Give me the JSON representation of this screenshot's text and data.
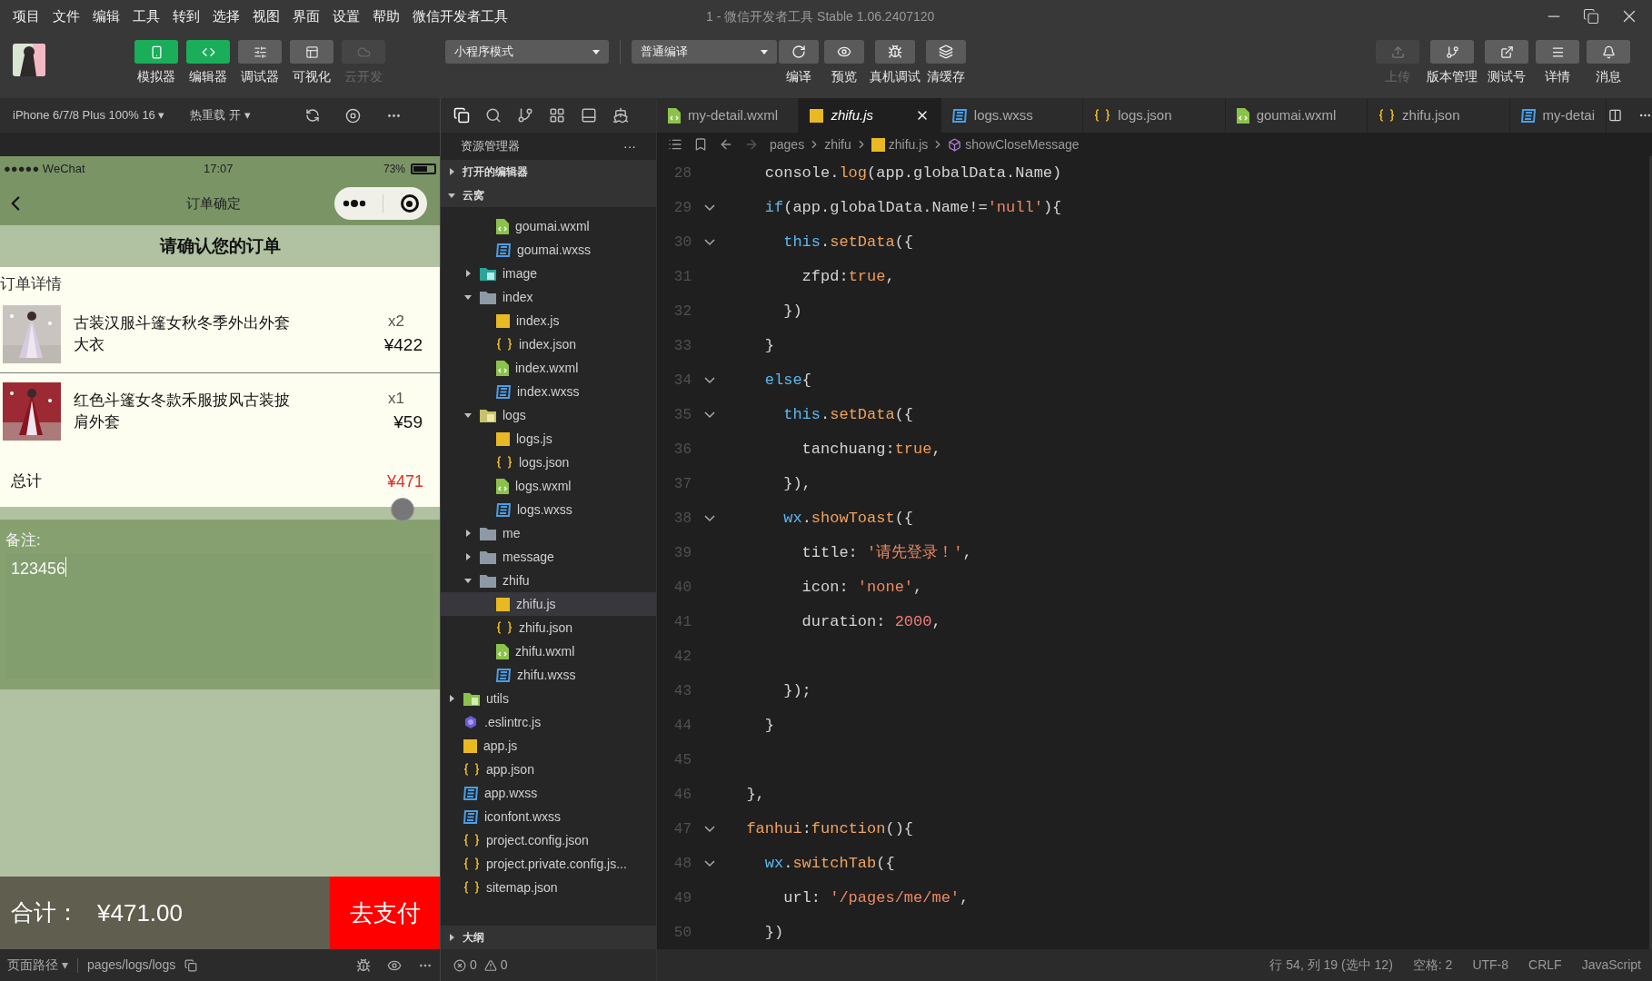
{
  "menu": [
    "项目",
    "文件",
    "编辑",
    "工具",
    "转到",
    "选择",
    "视图",
    "界面",
    "设置",
    "帮助",
    "微信开发者工具"
  ],
  "window": {
    "title": "1 - 微信开发者工具 Stable 1.06.2407120"
  },
  "toolbar": {
    "views": [
      {
        "label": "模拟器",
        "kind": "simulator",
        "on": true,
        "disabled": false
      },
      {
        "label": "编辑器",
        "kind": "editor",
        "on": true,
        "disabled": false
      },
      {
        "label": "调试器",
        "kind": "debugger",
        "on": false,
        "disabled": false
      },
      {
        "label": "可视化",
        "kind": "visual",
        "on": false,
        "disabled": false
      },
      {
        "label": "云开发",
        "kind": "cloud",
        "on": false,
        "disabled": true
      }
    ],
    "mode": "小程序模式",
    "compile": "普通编译",
    "actions": [
      {
        "label": "编译",
        "kind": "refresh"
      },
      {
        "label": "预览",
        "kind": "preview"
      },
      {
        "label": "真机调试",
        "kind": "bug"
      },
      {
        "label": "清缓存",
        "kind": "layers"
      }
    ],
    "right": [
      {
        "label": "上传",
        "kind": "upload",
        "disabled": true
      },
      {
        "label": "版本管理",
        "kind": "branch",
        "disabled": false
      },
      {
        "label": "测试号",
        "kind": "external",
        "disabled": false
      },
      {
        "label": "详情",
        "kind": "menu",
        "disabled": false
      },
      {
        "label": "消息",
        "kind": "bell",
        "disabled": false
      }
    ]
  },
  "simulator": {
    "device": "iPhone 6/7/8 Plus 100% 16 ▾",
    "hot_reload": "热重载 开 ▾",
    "status": {
      "carrier": "●●●●● WeChat",
      "time": "17:07",
      "battery": "73%"
    },
    "nav_title": "订单确定",
    "heading": "请确认您的订单",
    "section": "订单详情",
    "items": [
      {
        "name": "古装汉服斗篷女秋冬季外出外套大衣",
        "qty": "x2",
        "price": "¥422"
      },
      {
        "name": "红色斗篷女冬款禾服披风古装披肩外套",
        "qty": "x1",
        "price": "¥59"
      }
    ],
    "total_label": "总计",
    "total": "¥471",
    "remark_label": "备注:",
    "remark_value": "123456",
    "sum_label": "合计：",
    "sum": "¥471.00",
    "pay": "去支付",
    "path_label": "页面路径 ▾",
    "path": "pages/logs/logs"
  },
  "explorer": {
    "title": "资源管理器",
    "more": "···",
    "open_editors": {
      "label": "打开的编辑器",
      "expanded": false
    },
    "project": {
      "label": "云窝",
      "expanded": true
    },
    "outline": {
      "label": "大纲",
      "expanded": false
    }
  },
  "tree": {
    "items": [
      {
        "children": [
          {
            "children": [
              {
                "label": "goumai.wxml",
                "kind": "wxml",
                "selected": false
              },
              {
                "label": "goumai.wxss",
                "kind": "wxss",
                "selected": false
              }
            ]
          },
          {
            "label": "image",
            "kind": "image-folder",
            "expanded": false,
            "selected": false
          },
          {
            "label": "index",
            "kind": "folder",
            "expanded": true,
            "selected": false,
            "children": [
              {
                "label": "index.js",
                "kind": "js",
                "selected": false
              },
              {
                "label": "index.json",
                "kind": "json",
                "selected": false
              },
              {
                "label": "index.wxml",
                "kind": "wxml",
                "selected": false
              },
              {
                "label": "index.wxss",
                "kind": "wxss",
                "selected": false
              }
            ]
          },
          {
            "label": "logs",
            "kind": "logs-folder",
            "expanded": true,
            "selected": false,
            "children": [
              {
                "label": "logs.js",
                "kind": "js",
                "selected": false
              },
              {
                "label": "logs.json",
                "kind": "json",
                "selected": false
              },
              {
                "label": "logs.wxml",
                "kind": "wxml",
                "selected": false
              },
              {
                "label": "logs.wxss",
                "kind": "wxss",
                "selected": false
              }
            ]
          },
          {
            "label": "me",
            "kind": "folder",
            "expanded": false,
            "selected": false
          },
          {
            "label": "message",
            "kind": "folder",
            "expanded": false,
            "selected": false
          },
          {
            "label": "zhifu",
            "kind": "folder",
            "expanded": true,
            "selected": false,
            "children": [
              {
                "label": "zhifu.js",
                "kind": "js",
                "selected": true
              },
              {
                "label": "zhifu.json",
                "kind": "json",
                "selected": false
              },
              {
                "label": "zhifu.wxml",
                "kind": "wxml",
                "selected": false
              },
              {
                "label": "zhifu.wxss",
                "kind": "wxss",
                "selected": false
              }
            ]
          }
        ]
      },
      {
        "label": "utils",
        "kind": "utils-folder",
        "expanded": false,
        "selected": false
      },
      {
        "label": ".eslintrc.js",
        "kind": "eslint",
        "selected": false
      },
      {
        "label": "app.js",
        "kind": "js",
        "selected": false
      },
      {
        "label": "app.json",
        "kind": "json",
        "selected": false
      },
      {
        "label": "app.wxss",
        "kind": "wxss",
        "selected": false
      },
      {
        "label": "iconfont.wxss",
        "kind": "wxss",
        "selected": false
      },
      {
        "label": "project.config.json",
        "kind": "json",
        "selected": false
      },
      {
        "label": "project.private.config.js...",
        "kind": "json",
        "selected": false
      },
      {
        "label": "sitemap.json",
        "kind": "json",
        "selected": false
      }
    ]
  },
  "tabs": [
    {
      "label": "my-detail.wxml",
      "kind": "wxml",
      "selected": false
    },
    {
      "label": "zhifu.js",
      "kind": "js",
      "selected": true
    },
    {
      "label": "logs.wxss",
      "kind": "wxss",
      "selected": false
    },
    {
      "label": "logs.json",
      "kind": "json",
      "selected": false
    },
    {
      "label": "goumai.wxml",
      "kind": "wxml",
      "selected": false
    },
    {
      "label": "zhifu.json",
      "kind": "json",
      "selected": false
    },
    {
      "label": "my-detai",
      "kind": "wxss",
      "selected": false
    }
  ],
  "breadcrumb": [
    "pages",
    "zhifu",
    "zhifu.js",
    "showCloseMessage"
  ],
  "code": [
    {
      "number": "28",
      "fold": false,
      "tokens": [
        {
          "text": "    console.",
          "kind": "plain"
        },
        {
          "text": "log",
          "kind": "function"
        },
        {
          "text": "(app.globalData.Name)",
          "kind": "plain"
        }
      ]
    },
    {
      "number": "29",
      "fold": true,
      "tokens": [
        {
          "text": "    if",
          "kind": "keyword"
        },
        {
          "text": "(app.globalData.Name!=",
          "kind": "plain"
        },
        {
          "text": "'null'",
          "kind": "string"
        },
        {
          "text": "){",
          "kind": "plain"
        }
      ]
    },
    {
      "number": "30",
      "fold": true,
      "tokens": [
        {
          "text": "      this",
          "kind": "keyword"
        },
        {
          "text": ".",
          "kind": "plain"
        },
        {
          "text": "setData",
          "kind": "function"
        },
        {
          "text": "({",
          "kind": "plain"
        }
      ]
    },
    {
      "number": "31",
      "fold": false,
      "tokens": [
        {
          "text": "        zfpd:",
          "kind": "plain"
        },
        {
          "text": "true",
          "kind": "literal"
        },
        {
          "text": ",",
          "kind": "plain"
        }
      ]
    },
    {
      "number": "32",
      "fold": false,
      "tokens": [
        {
          "text": "      })",
          "kind": "plain"
        }
      ]
    },
    {
      "number": "33",
      "fold": false,
      "tokens": [
        {
          "text": "    }",
          "kind": "plain"
        }
      ]
    },
    {
      "number": "34",
      "fold": true,
      "tokens": [
        {
          "text": "    else",
          "kind": "keyword"
        },
        {
          "text": "{",
          "kind": "plain"
        }
      ]
    },
    {
      "number": "35",
      "fold": true,
      "tokens": [
        {
          "text": "      this",
          "kind": "keyword"
        },
        {
          "text": ".",
          "kind": "plain"
        },
        {
          "text": "setData",
          "kind": "function"
        },
        {
          "text": "({",
          "kind": "plain"
        }
      ]
    },
    {
      "number": "36",
      "fold": false,
      "tokens": [
        {
          "text": "        tanchuang:",
          "kind": "plain"
        },
        {
          "text": "true",
          "kind": "literal"
        },
        {
          "text": ",",
          "kind": "plain"
        }
      ]
    },
    {
      "number": "37",
      "fold": false,
      "tokens": [
        {
          "text": "      }),",
          "kind": "plain"
        }
      ]
    },
    {
      "number": "38",
      "fold": true,
      "tokens": [
        {
          "text": "      wx",
          "kind": "keyword"
        },
        {
          "text": ".",
          "kind": "plain"
        },
        {
          "text": "showToast",
          "kind": "function"
        },
        {
          "text": "({",
          "kind": "plain"
        }
      ]
    },
    {
      "number": "39",
      "fold": false,
      "tokens": [
        {
          "text": "        title: ",
          "kind": "plain"
        },
        {
          "text": "'请先登录！'",
          "kind": "string"
        },
        {
          "text": ",",
          "kind": "plain"
        }
      ]
    },
    {
      "number": "40",
      "fold": false,
      "tokens": [
        {
          "text": "        icon: ",
          "kind": "plain"
        },
        {
          "text": "'none'",
          "kind": "string"
        },
        {
          "text": ",",
          "kind": "plain"
        }
      ]
    },
    {
      "number": "41",
      "fold": false,
      "tokens": [
        {
          "text": "        duration: ",
          "kind": "plain"
        },
        {
          "text": "2000",
          "kind": "number"
        },
        {
          "text": ",",
          "kind": "plain"
        }
      ]
    },
    {
      "number": "42",
      "fold": false
    },
    {
      "number": "43",
      "fold": false,
      "tokens": [
        {
          "text": "      });",
          "kind": "plain"
        }
      ]
    },
    {
      "number": "44",
      "fold": false,
      "tokens": [
        {
          "text": "    }",
          "kind": "plain"
        }
      ]
    },
    {
      "number": "45",
      "fold": false
    },
    {
      "number": "46",
      "fold": false,
      "tokens": [
        {
          "text": "  },",
          "kind": "plain"
        }
      ]
    },
    {
      "number": "47",
      "fold": true,
      "tokens": [
        {
          "text": "  fanhui",
          "kind": "function"
        },
        {
          "text": ":",
          "kind": "plain"
        },
        {
          "text": "function",
          "kind": "function"
        },
        {
          "text": "(){",
          "kind": "plain"
        }
      ]
    },
    {
      "number": "48",
      "fold": true,
      "tokens": [
        {
          "text": "    wx",
          "kind": "keyword"
        },
        {
          "text": ".",
          "kind": "plain"
        },
        {
          "text": "switchTab",
          "kind": "function"
        },
        {
          "text": "({",
          "kind": "plain"
        }
      ]
    },
    {
      "number": "49",
      "fold": false,
      "tokens": [
        {
          "text": "      url: ",
          "kind": "plain"
        },
        {
          "text": "'/pages/me/me'",
          "kind": "string"
        },
        {
          "text": ",",
          "kind": "plain"
        }
      ]
    },
    {
      "number": "50",
      "fold": false,
      "tokens": [
        {
          "text": "    })",
          "kind": "plain"
        }
      ]
    }
  ],
  "problems": {
    "errors": "0",
    "warnings": "0"
  },
  "status_bar": [
    "行 54, 列 19 (选中 12)",
    "空格: 2",
    "UTF-8",
    "CRLF",
    "JavaScript"
  ]
}
